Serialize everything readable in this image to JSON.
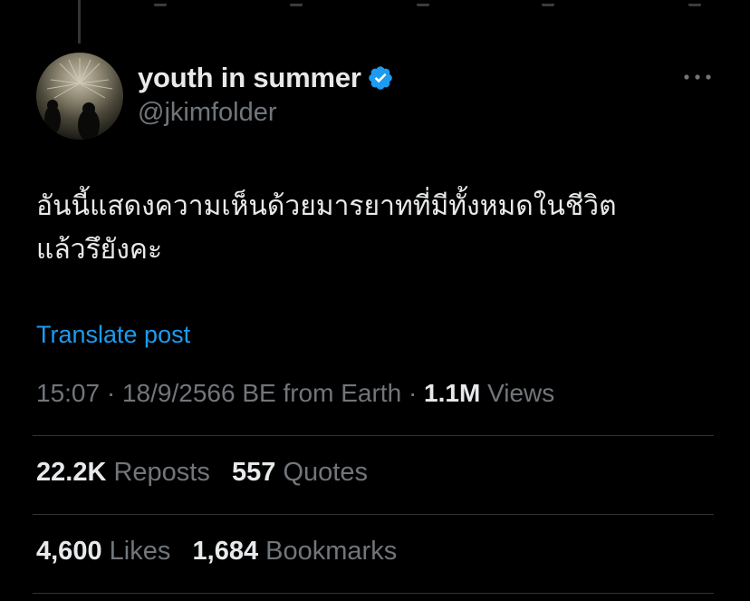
{
  "user": {
    "display_name": "youth in summer",
    "handle": "@jkimfolder",
    "verified": true
  },
  "post": {
    "text_line1": "อันนี้แสดงความเห็นด้วยมารยาทที่มีทั้งหมดในชีวิต",
    "text_line2": "แล้วรึยังคะ",
    "translate_label": "Translate post",
    "time": "15:07",
    "sep": "·",
    "date": "18/9/2566 BE from Earth",
    "views_count": "1.1M",
    "views_label": "Views"
  },
  "stats": {
    "reposts_count": "22.2K",
    "reposts_label": "Reposts",
    "quotes_count": "557",
    "quotes_label": "Quotes",
    "likes_count": "4,600",
    "likes_label": "Likes",
    "bookmarks_count": "1,684",
    "bookmarks_label": "Bookmarks"
  },
  "icons": {
    "verified": "verified-badge-icon",
    "more": "more-options-icon"
  },
  "colors": {
    "background": "#000000",
    "text_primary": "#e7e9ea",
    "text_secondary": "#71767b",
    "accent": "#1d9bf0",
    "divider": "#2f3336"
  }
}
